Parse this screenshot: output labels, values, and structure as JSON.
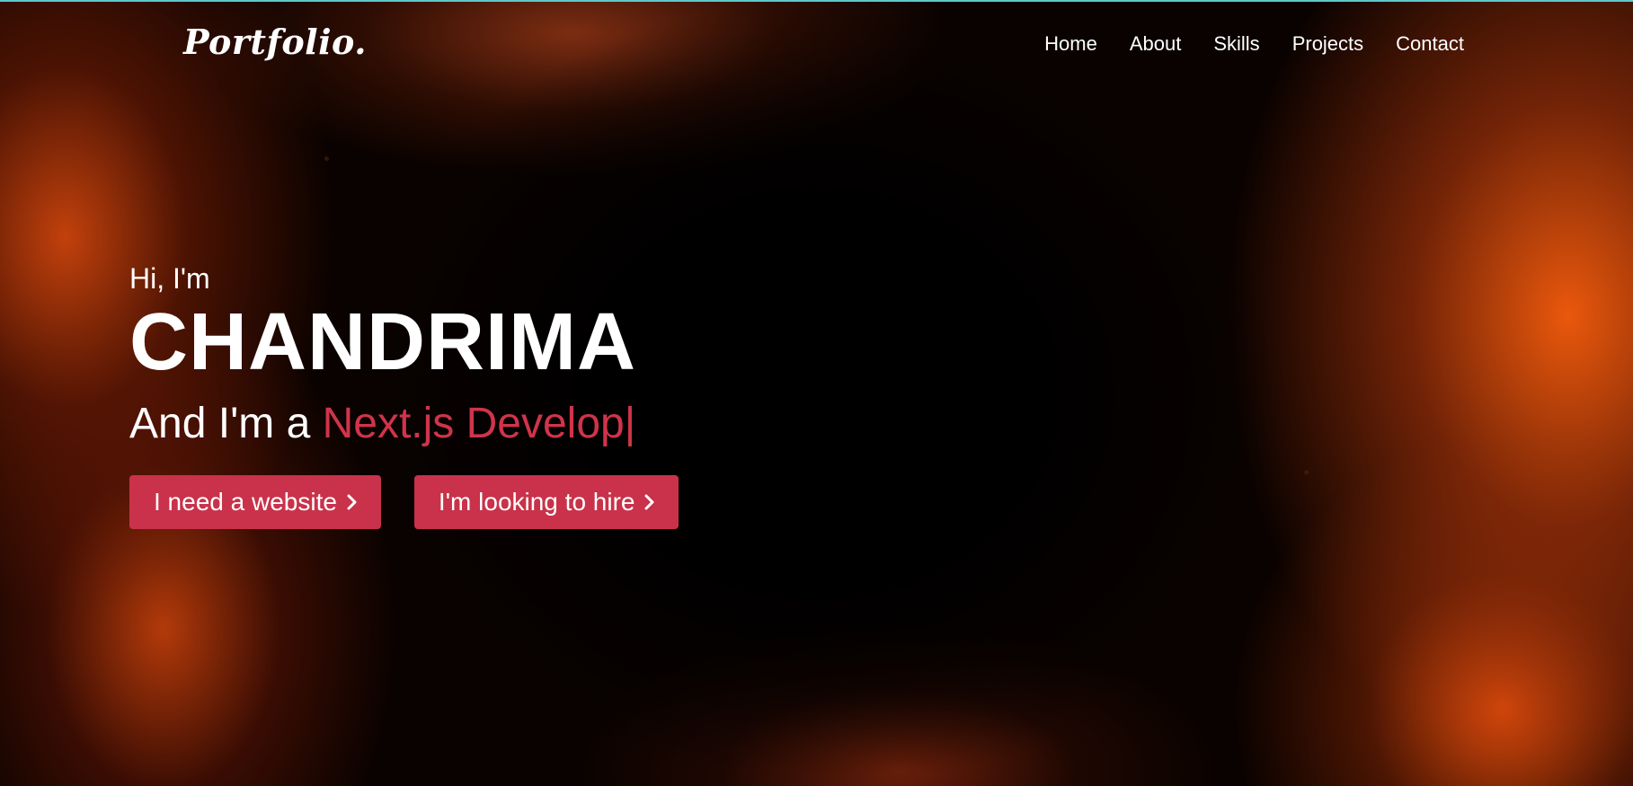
{
  "header": {
    "logo": "Portfolio.",
    "nav": [
      "Home",
      "About",
      "Skills",
      "Projects",
      "Contact"
    ]
  },
  "hero": {
    "greeting": "Hi, I'm",
    "name": "CHANDRIMA",
    "role_prefix": "And I'm a ",
    "role_typed": "Next.js Develop",
    "cursor": "|",
    "buttons": [
      {
        "label": "I need a website",
        "icon": "chevron-right-icon"
      },
      {
        "label": "I'm looking to hire",
        "icon": "chevron-right-icon"
      }
    ]
  },
  "colors": {
    "accent": "#d0344a",
    "button": "#c9324a",
    "text": "#ffffff"
  }
}
